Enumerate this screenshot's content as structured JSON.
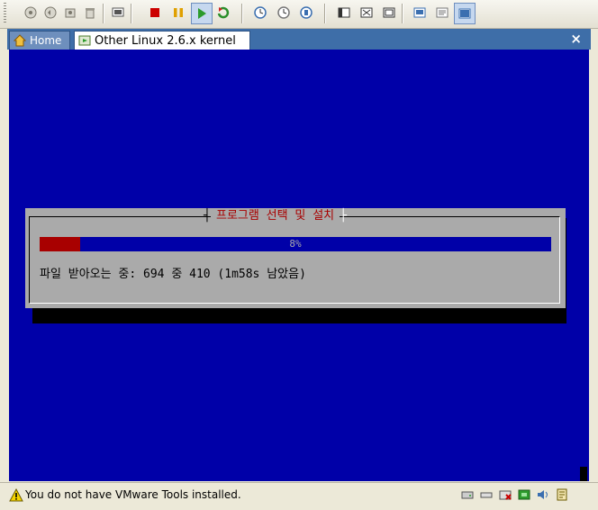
{
  "toolbar": {
    "colors": {
      "stop": "#cc0000",
      "pause": "#e0a000",
      "play": "#2c9b2c",
      "reset": "#2b8f2b"
    },
    "buttons": [
      "snapshot-icon",
      "revert-icon",
      "snapshot-manager-icon",
      "trash-icon",
      "console-icon",
      "stop-icon",
      "pause-icon",
      "play-icon",
      "reset-icon",
      "clock-icon",
      "clock2-icon",
      "clock3-icon",
      "sidebar-icon",
      "fullscreen-icon",
      "quickswitch-icon",
      "console-view-icon",
      "summary-view-icon",
      "vm-view-icon"
    ]
  },
  "tabs": {
    "home_label": "Home",
    "active_label": "Other Linux 2.6.x kernel",
    "close_glyph": "×"
  },
  "screen": {
    "background": "#0000a8",
    "dialog": {
      "title": "프로그램 선택 및 설치",
      "progress_text": "8%",
      "progress_value": 0.08,
      "message": "파일 받아오는 중: 694 중 410 (1m58s 남았음)"
    }
  },
  "statusbar": {
    "message": "You do not have VMware Tools installed.",
    "devices": [
      "harddisk-icon",
      "floppy-icon",
      "cdrom-icon",
      "network-icon",
      "sound-icon",
      "usb-icon"
    ]
  }
}
